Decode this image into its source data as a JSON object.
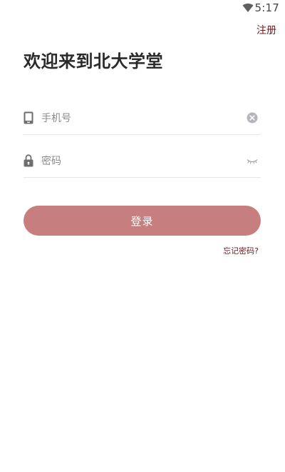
{
  "status_bar": {
    "time": "5:17",
    "wifi_icon": "wifi-icon"
  },
  "header": {
    "register_label": "注册"
  },
  "main": {
    "title": "欢迎来到北大学堂",
    "phone_field": {
      "placeholder": "手机号",
      "value": "",
      "lead_icon": "phone-icon",
      "trail_icon": "clear-icon"
    },
    "password_field": {
      "placeholder": "密码",
      "value": "",
      "lead_icon": "lock-icon",
      "trail_icon": "eye-closed-icon"
    },
    "login_label": "登录",
    "forgot_label": "忘记密码?"
  },
  "colors": {
    "accent": "#c77e7e",
    "link": "#6b1a22",
    "divider": "#e6e6e6"
  }
}
